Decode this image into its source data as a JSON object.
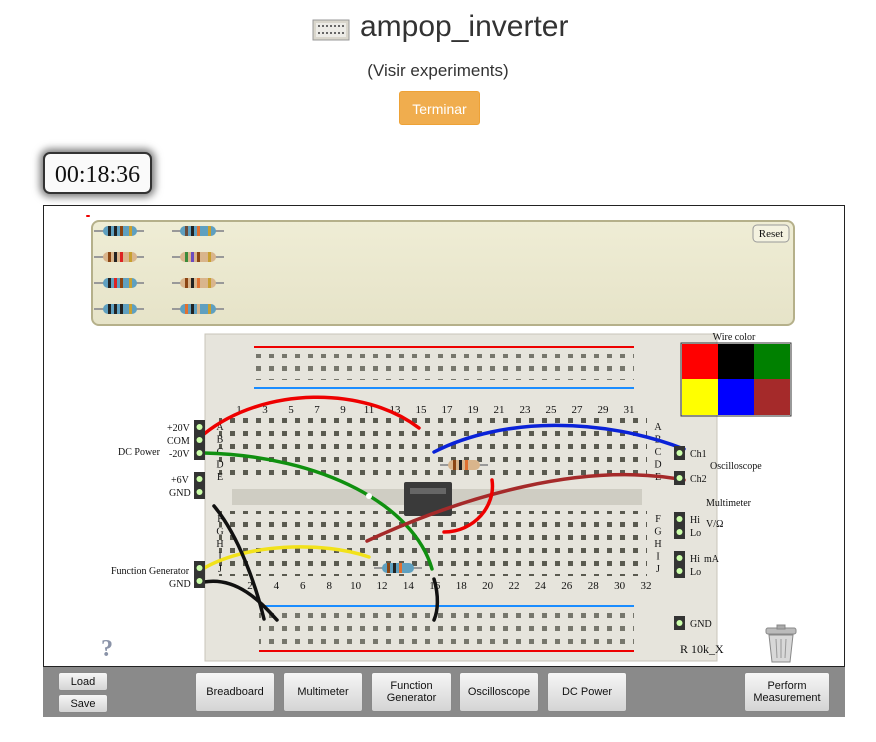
{
  "header": {
    "title": "ampop_inverter",
    "subtitle": "(Visir experiments)",
    "button": "Terminar"
  },
  "timer": "00:18:36",
  "component_tray": {
    "reset": "Reset"
  },
  "breadboard": {
    "top_numbers": [
      "1",
      "3",
      "5",
      "7",
      "9",
      "11",
      "13",
      "15",
      "17",
      "19",
      "21",
      "23",
      "25",
      "27",
      "29",
      "31"
    ],
    "bottom_numbers": [
      "2",
      "4",
      "6",
      "8",
      "10",
      "12",
      "14",
      "16",
      "18",
      "20",
      "22",
      "24",
      "26",
      "28",
      "30",
      "32"
    ],
    "row_letters_top": [
      "A",
      "B",
      "C",
      "D",
      "E"
    ],
    "row_letters_bottom": [
      "F",
      "G",
      "H",
      "I",
      "J"
    ]
  },
  "dc_power": {
    "label": "DC Power",
    "plus20": "+20V",
    "com": "COM",
    "minus20": "-20V",
    "plus6": "+6V",
    "gnd": "GND"
  },
  "function_generator": {
    "label": "Function Generator",
    "gnd": "GND"
  },
  "wire_color": {
    "title": "Wire color",
    "colors": [
      "#ff0000",
      "#000000",
      "#008000",
      "#ffff00",
      "#0000ff",
      "#a52a2a"
    ]
  },
  "oscilloscope": {
    "label": "Oscilloscope",
    "ch1": "Ch1",
    "ch2": "Ch2"
  },
  "multimeter": {
    "label": "Multimeter",
    "hi1": "Hi",
    "lo1": "Lo",
    "volt_ohm": "V/Ω",
    "hi2": "Hi",
    "lo2": "Lo",
    "ma": "mA"
  },
  "ground": {
    "label": "GND"
  },
  "component_label": "R 10k_X",
  "help": "?",
  "toolbar": {
    "load": "Load",
    "save": "Save",
    "breadboard": "Breadboard",
    "multimeter": "Multimeter",
    "function_generator_1": "Function",
    "function_generator_2": "Generator",
    "oscilloscope": "Oscilloscope",
    "dc_power": "DC Power",
    "perform_1": "Perform",
    "perform_2": "Measurement"
  }
}
